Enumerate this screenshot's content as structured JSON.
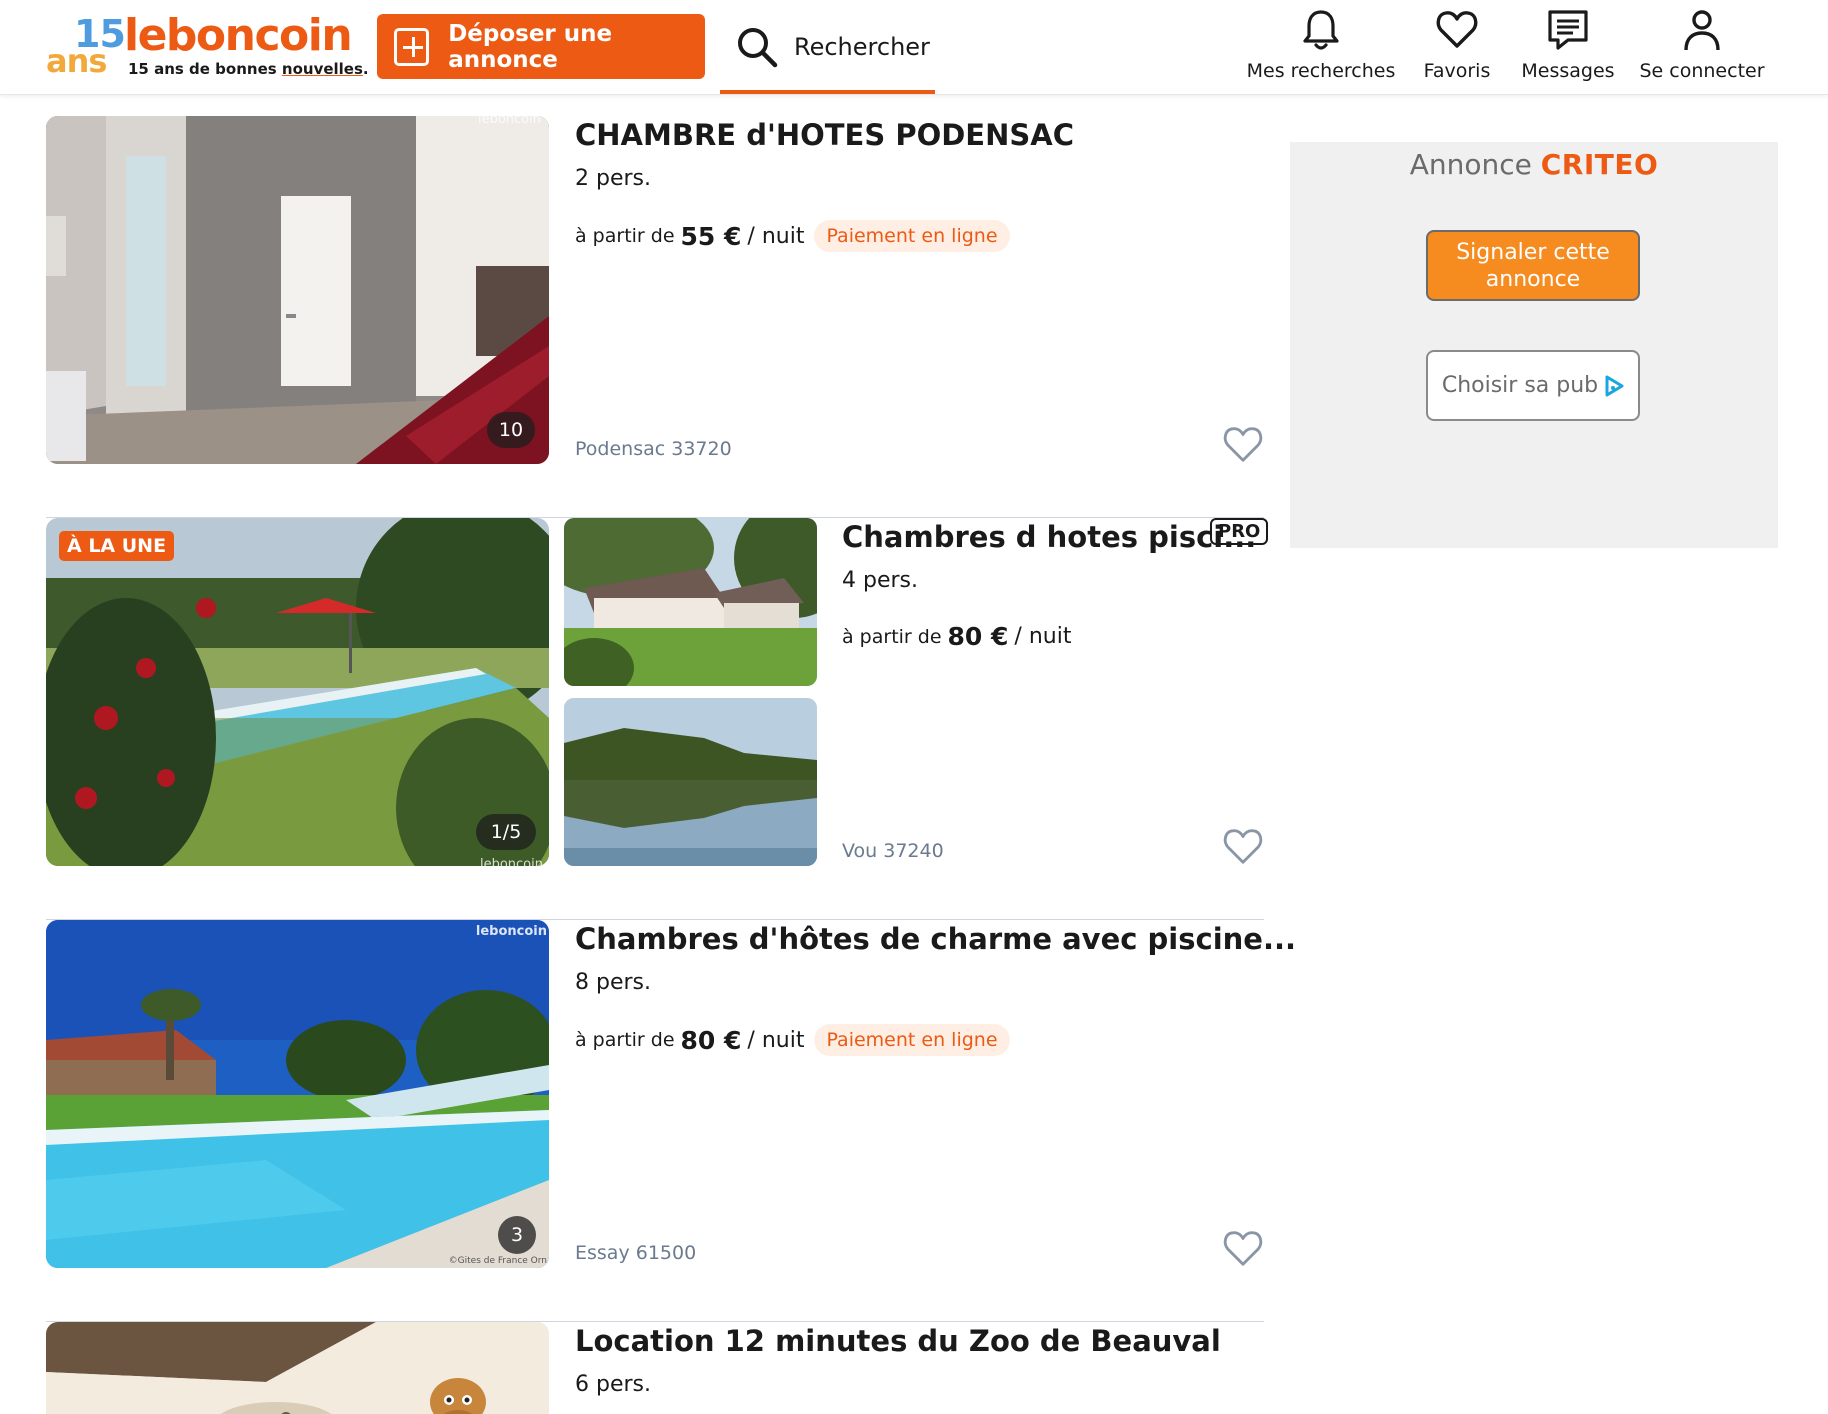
{
  "header": {
    "logo": {
      "anniv_number": "15",
      "anniv_word": "ans",
      "brand": "leboncoin",
      "tagline_prefix": "15 ans de bonnes ",
      "tagline_highlight": "nouvelles",
      "tagline_suffix": "."
    },
    "deposit_label": "Déposer une annonce",
    "search_label": "Rechercher",
    "nav": [
      {
        "label": "Mes recherches",
        "icon": "bell-icon"
      },
      {
        "label": "Favoris",
        "icon": "heart-icon"
      },
      {
        "label": "Messages",
        "icon": "message-icon"
      },
      {
        "label": "Se connecter",
        "icon": "user-icon"
      }
    ]
  },
  "colors": {
    "brand": "#ec5a13",
    "location_text": "#6b7a8f",
    "badge_bg": "#ffeee3"
  },
  "listings": [
    {
      "title": "CHAMBRE d'HOTES PODENSAC",
      "capacity": "2 pers.",
      "price_prefix": "à partir de",
      "price": "55 €",
      "price_unit": "/ nuit",
      "payment_badge": "Paiement en ligne",
      "location": "Podensac 33720",
      "photo_count": "10",
      "photo_watermark": "leboncoin"
    },
    {
      "title": "Chambres d hotes pisci...",
      "pro_badge": "PRO",
      "featured_badge": "À LA UNE",
      "capacity": "4 pers.",
      "price_prefix": "à partir de",
      "price": "80 €",
      "price_unit": "/ nuit",
      "location": "Vou 37240",
      "photo_count": "1/5",
      "photo_watermark": "leboncoin"
    },
    {
      "title": "Chambres d'hôtes de charme avec piscine...",
      "capacity": "8 pers.",
      "price_prefix": "à partir de",
      "price": "80 €",
      "price_unit": "/ nuit",
      "payment_badge": "Paiement en ligne",
      "location": "Essay 61500",
      "photo_count": "3",
      "photo_watermark": "leboncoin",
      "photo_credit": "©Gites de France Orn"
    },
    {
      "title": "Location 12 minutes du Zoo de Beauval",
      "capacity": "6 pers."
    }
  ],
  "ad": {
    "label": "Annonce",
    "brand": "CRITEO",
    "report_label": "Signaler cette annonce",
    "choose_label": "Choisir sa pub"
  }
}
